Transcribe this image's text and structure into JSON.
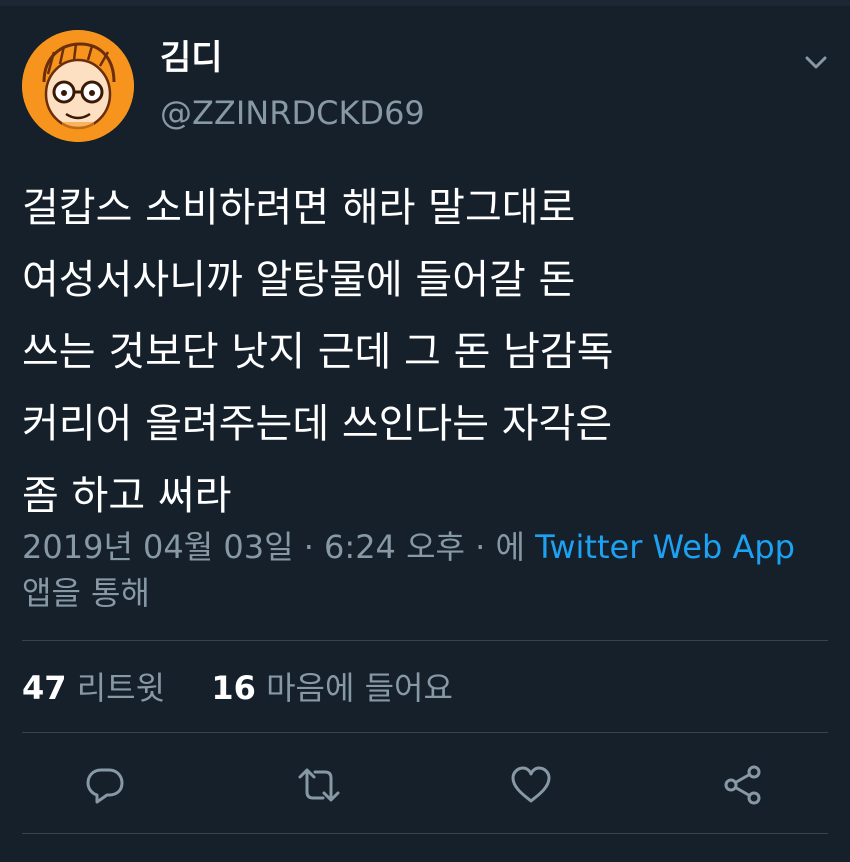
{
  "header": {
    "display_name": "김디",
    "handle": "@ZZINRDCKD69",
    "menu_icon": "chevron-down-icon"
  },
  "tweet": {
    "lines": [
      "걸캅스 소비하려면 해라 말그대로",
      "여성서사니까 알탕물에 들어갈 돈",
      "쓰는 것보단 낫지 근데 그 돈 남감독",
      "커리어 올려주는데 쓰인다는 자각은",
      "좀 하고 써라"
    ]
  },
  "meta": {
    "timestamp": "2019년 04월 03일 · 6:24 오후 · 에",
    "source": "Twitter Web App",
    "suffix": "앱을 통해"
  },
  "stats": {
    "retweet_count": "47",
    "retweet_label": "리트윗",
    "like_count": "16",
    "like_label": "마음에 들어요"
  },
  "actions": [
    "reply-icon",
    "retweet-icon",
    "like-icon",
    "share-icon"
  ],
  "colors": {
    "background": "#15202b",
    "text_primary": "#ffffff",
    "text_secondary": "#8899a6",
    "link": "#1da1f2",
    "divider": "#38444d",
    "avatar_bg": "#f7941d"
  }
}
